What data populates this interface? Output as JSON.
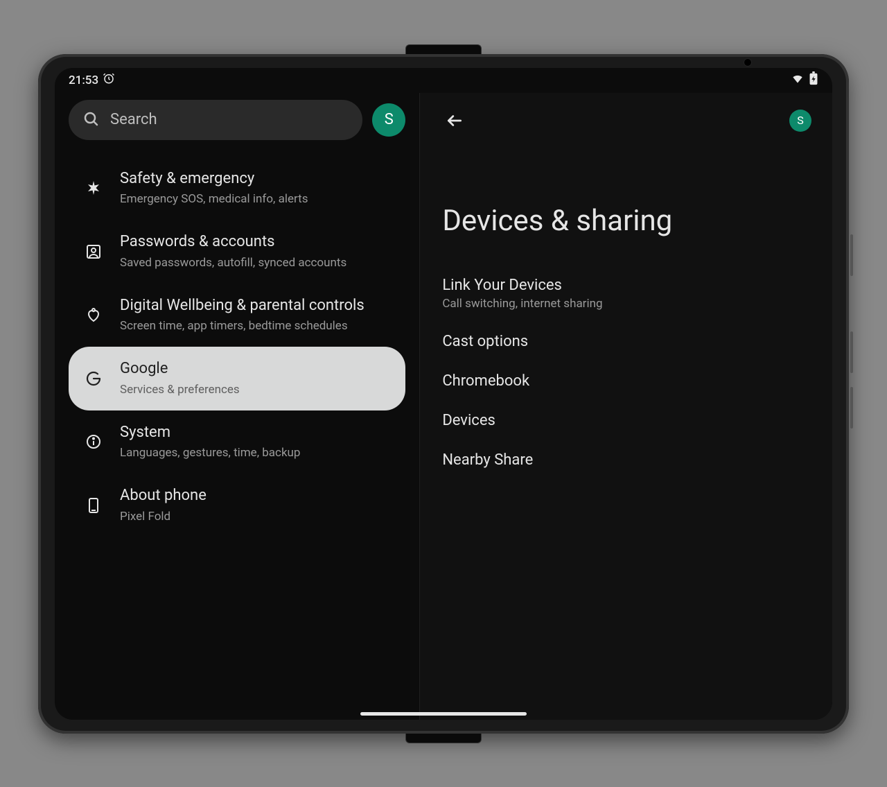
{
  "status": {
    "time": "21:53",
    "avatar_initial": "S",
    "avatar_color": "#0d8a6b"
  },
  "search": {
    "placeholder": "Search"
  },
  "settings_items": [
    {
      "title": "Safety & emergency",
      "subtitle": "Emergency SOS, medical info, alerts",
      "icon": "asterisk"
    },
    {
      "title": "Passwords & accounts",
      "subtitle": "Saved passwords, autofill, synced accounts",
      "icon": "account-box"
    },
    {
      "title": "Digital Wellbeing & parental controls",
      "subtitle": "Screen time, app timers, bedtime schedules",
      "icon": "wellbeing"
    },
    {
      "title": "Google",
      "subtitle": "Services & preferences",
      "icon": "google",
      "selected": true
    },
    {
      "title": "System",
      "subtitle": "Languages, gestures, time, backup",
      "icon": "info"
    },
    {
      "title": "About phone",
      "subtitle": "Pixel Fold",
      "icon": "phone-outline"
    }
  ],
  "detail": {
    "title": "Devices & sharing",
    "items": [
      {
        "title": "Link Your Devices",
        "subtitle": "Call switching, internet sharing"
      },
      {
        "title": "Cast options"
      },
      {
        "title": "Chromebook"
      },
      {
        "title": "Devices"
      },
      {
        "title": "Nearby Share"
      }
    ]
  }
}
